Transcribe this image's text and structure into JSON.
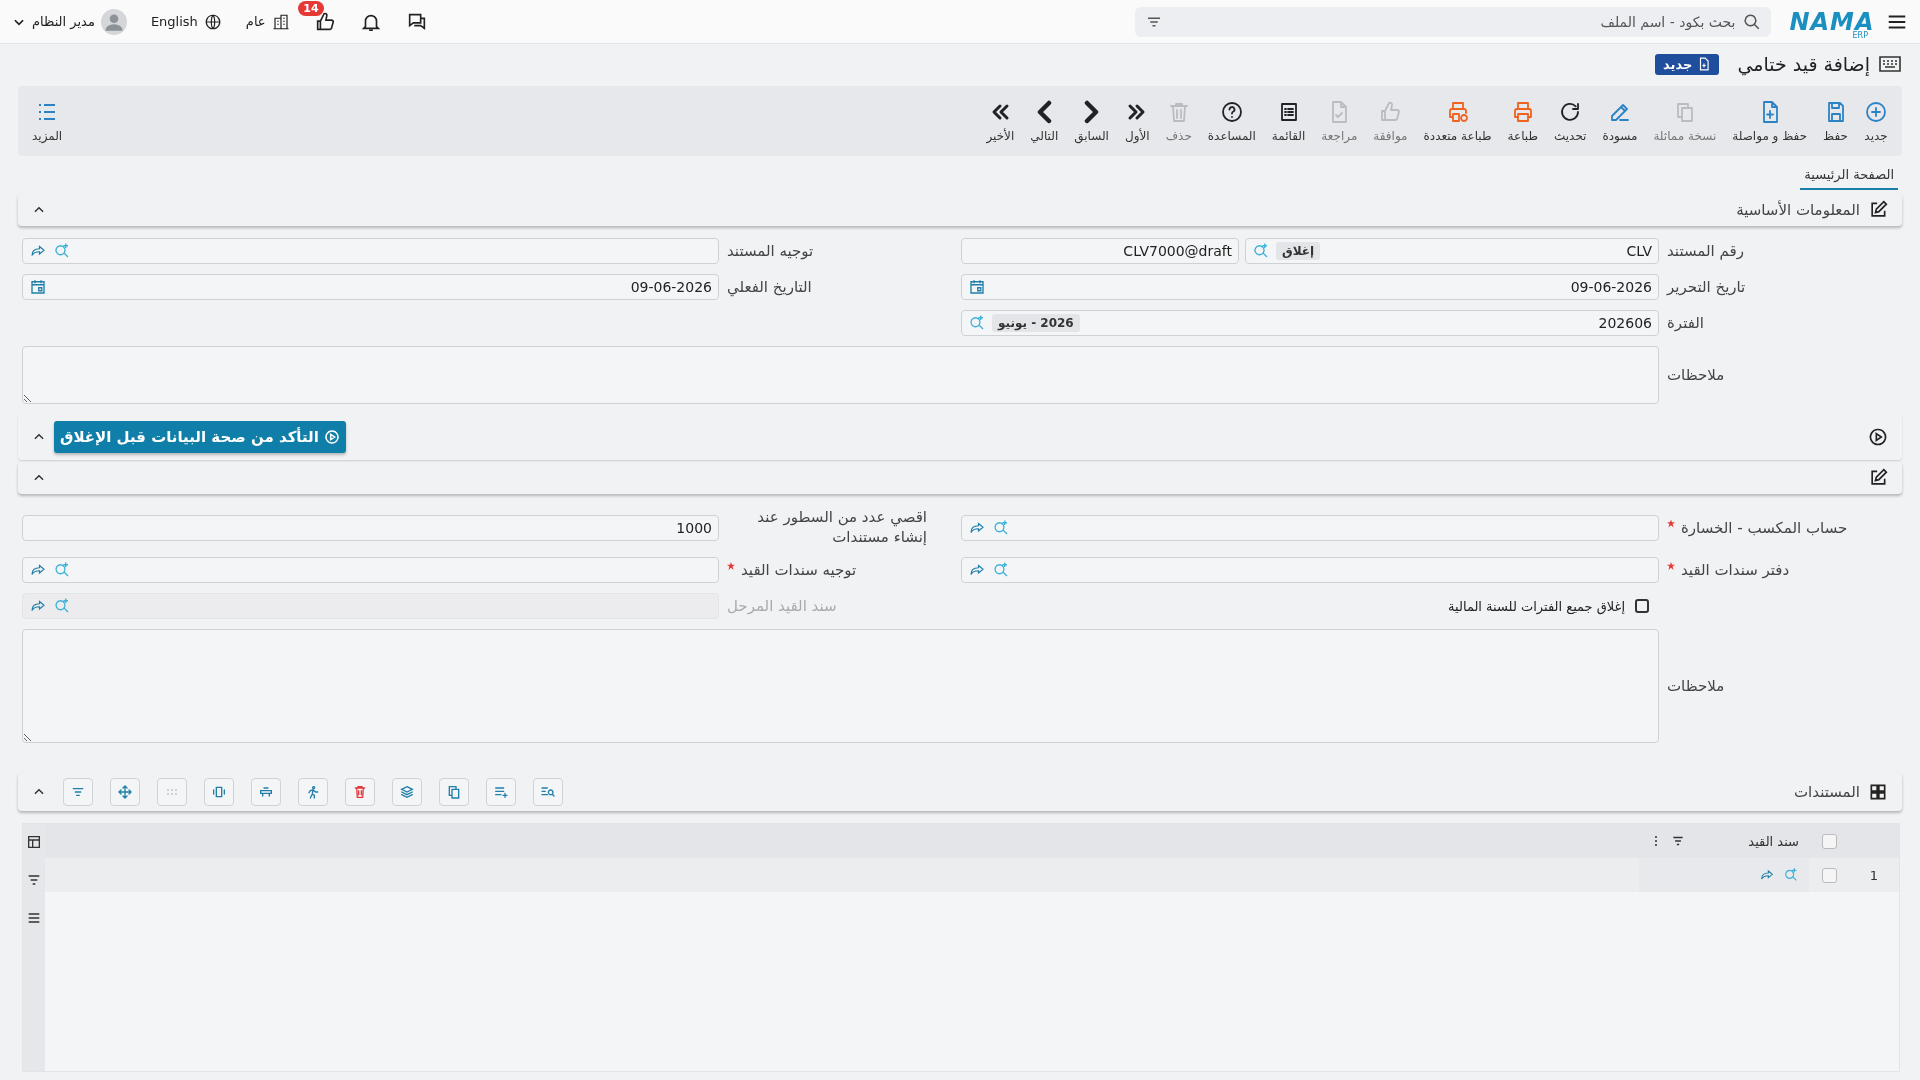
{
  "topbar": {
    "logo": "NAMA",
    "logo_sub": "ERP",
    "search": {
      "placeholder": "بحث بكود - اسم الملف"
    },
    "notification_count": "14",
    "branch": "عام",
    "language": "English",
    "user": "مدير النظام"
  },
  "page": {
    "title": "إضافة قيد ختامي",
    "status": "جديد"
  },
  "toolbar": [
    {
      "label": "جديد",
      "color": "#2b83c6",
      "disabled": false
    },
    {
      "label": "حفظ",
      "color": "#2b83c6",
      "disabled": false
    },
    {
      "label": "حفظ و مواصلة",
      "color": "#2b83c6",
      "disabled": false
    },
    {
      "label": "نسخة مماثلة",
      "color": "#b9bcc0",
      "disabled": true
    },
    {
      "label": "مسودة",
      "color": "#2b83c6",
      "disabled": false
    },
    {
      "label": "تحديث",
      "color": "#1f2328",
      "disabled": false
    },
    {
      "label": "طباعة",
      "color": "#f0621e",
      "disabled": false
    },
    {
      "label": "طباعة متعددة",
      "color": "#f0621e",
      "disabled": false
    },
    {
      "label": "موافقة",
      "color": "#b9bcc0",
      "disabled": true
    },
    {
      "label": "مراجعة",
      "color": "#b9bcc0",
      "disabled": true
    },
    {
      "label": "القائمة",
      "color": "#1f2328",
      "disabled": false
    },
    {
      "label": "المساعدة",
      "color": "#1f2328",
      "disabled": false
    },
    {
      "label": "حذف",
      "color": "#b9bcc0",
      "disabled": true
    },
    {
      "label": "الأول",
      "color": "#1f2328",
      "disabled": false
    },
    {
      "label": "السابق",
      "color": "#1f2328",
      "disabled": false
    },
    {
      "label": "التالي",
      "color": "#1f2328",
      "disabled": false
    },
    {
      "label": "الأخير",
      "color": "#1f2328",
      "disabled": false
    }
  ],
  "more": "المزيد",
  "tabs": [
    {
      "label": "الصفحة الرئيسية",
      "selected": true
    }
  ],
  "basic_info": {
    "title": "المعلومات الأساسية",
    "expanded": true,
    "doc_number": {
      "label": "رقم المستند",
      "prefix": "CLV",
      "status": "إغلاق",
      "value": "CLV7000@draft"
    },
    "doc_direction": {
      "label": "توجيه المستند"
    },
    "edit_date": {
      "label": "تاريخ التحرير",
      "value": "09-06-2026"
    },
    "actual_date": {
      "label": "التاريخ الفعلي",
      "value": "09-06-2026"
    },
    "period": {
      "label": "الفترة",
      "value": "202606",
      "tag": "2026 - يونيو"
    },
    "notes": {
      "label": "ملاحظات"
    }
  },
  "validate": {
    "expanded": true,
    "button": "التأكد من صحة البيانات قبل الإغلاق"
  },
  "closing": {
    "expanded": true,
    "profit_loss_account": {
      "label": "حساب المكسب - الخسارة",
      "required": true
    },
    "max_lines": {
      "label": "اقصي عدد من السطور عند إنشاء مستندات",
      "value": "1000"
    },
    "journal_book": {
      "label": "دفتر سندات القيد",
      "required": true
    },
    "journal_direction": {
      "label": "توجيه سندات القيد",
      "required": true
    },
    "close_all_periods": {
      "label": "إغلاق جميع الفترات للسنة المالية",
      "checked": false
    },
    "carried_voucher": {
      "label": "سند القيد المرحل",
      "disabled": true
    },
    "notes": {
      "label": "ملاحظات"
    }
  },
  "documents": {
    "title": "المستندات",
    "expanded": true,
    "all_selected": false,
    "columns": [
      {
        "label": "سند القيد"
      }
    ],
    "rows": [
      {
        "number": "1",
        "selected": false
      }
    ]
  }
}
